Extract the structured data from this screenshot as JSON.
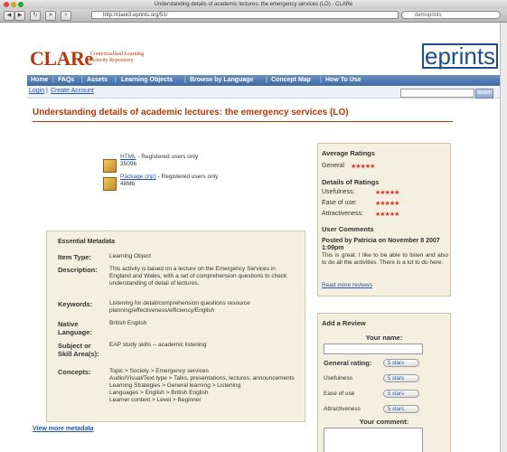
{
  "browser": {
    "window_title": "Understanding details of academic lectures: the emergency services (LO) - CLARe",
    "url": "http://clare3.eprints.org/51/",
    "search": "demoprints"
  },
  "header": {
    "logo": "CLARe",
    "logo_sub_1": "Contextualised Learning",
    "logo_sub_2": "Activity Repository",
    "eprints_logo": "eprints"
  },
  "nav": {
    "items": [
      "Home",
      "FAQs",
      "Assets",
      "Learning Objects",
      "Browse by Language",
      "Concept Map",
      "How To Use"
    ],
    "login": "Login",
    "create_account": "Create Account",
    "search_button": "Search"
  },
  "page": {
    "title": "Understanding details of academic lectures: the emergency services (LO)"
  },
  "downloads": [
    {
      "link": "HTML",
      "note": " - Registered users only",
      "size": "3509b"
    },
    {
      "link": "Package (zip)",
      "note": " - Registered users only",
      "size": "48Mb"
    }
  ],
  "ratings": {
    "heading": "Average Ratings",
    "general_label": "General",
    "details_heading": "Details of Ratings",
    "usefulness_label": "Usefulness:",
    "ease_label": "Ease of use:",
    "attract_label": "Attractiveness:",
    "stars": "★★★★★",
    "values": {
      "general": 5,
      "usefulness": 5,
      "ease_of_use": 5,
      "attractiveness": 5
    }
  },
  "comments": {
    "heading": "User Comments",
    "author": "Posted by Patricia on November 8 2007 1:09pm",
    "text": "This is great. I like to be able to listen and also to do all the activities. There is a lot to do here.",
    "read_more": "Read more reviews"
  },
  "review": {
    "heading": "Add a Review",
    "name_label": "Your name:",
    "general_label": "General rating:",
    "usefulness_label": "Usefulness",
    "ease_label": "Ease of use",
    "attract_label": "Attractiveness",
    "select_value": "5 stars",
    "comment_label": "Your comment:"
  },
  "metadata": {
    "heading": "Essential Metadata",
    "rows": [
      {
        "key": "Item Type:",
        "value": "Learning Object"
      },
      {
        "key": "Description:",
        "value": "This activity is based on a lecture on the Emergency Services in England and Wales, with a set of comprehension questions to check understanding of detail of lectures."
      },
      {
        "key": "Keywords:",
        "value": "Listening for detail/comprehension questions resource planning/effectiveness/efficiency/English"
      },
      {
        "key": "Native Language:",
        "value": "British English"
      },
      {
        "key": "Subject or Skill Area(s):",
        "value": "EAP study skills -- academic listening"
      },
      {
        "key": "Concepts:",
        "value": "Topic > Society > Emergency services\nAudio/Visual/Text type > Talks, presentations, lectures, announcements\nLearning Strategies > General learning > Listening\nLanguages > English > British English\nLearner context > Level > Beginner"
      }
    ],
    "view_more": "View more metadata"
  }
}
